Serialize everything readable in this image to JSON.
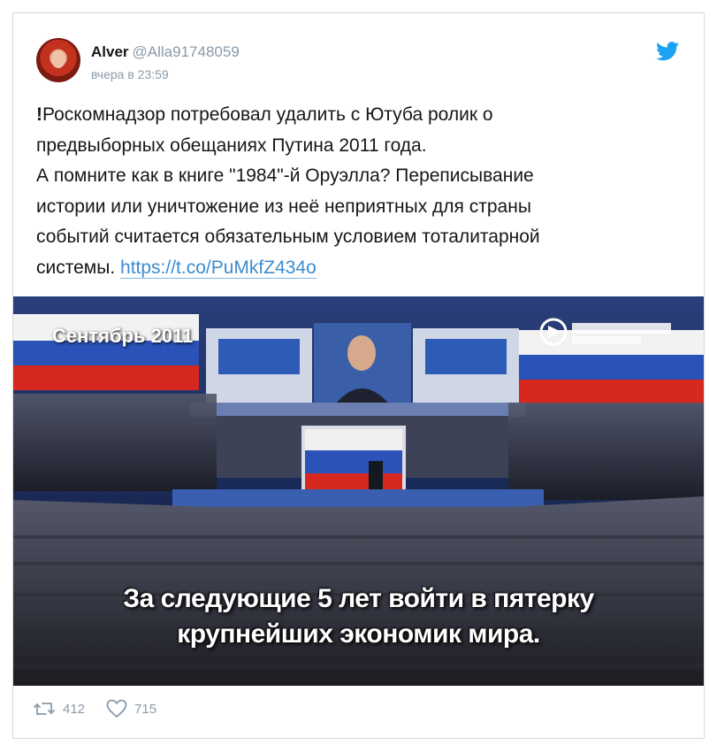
{
  "tweet": {
    "author_name": "Alver",
    "author_handle": "@Alla91748059",
    "timestamp": "вчера в 23:59",
    "text_lines": [
      "Роскомнадзор потребовал удалить с Ютуба ролик о",
      "предвыборных обещаниях Путина 2011 года.",
      "А помните как в книге \"1984\"-й Оруэлла? Переписывание",
      "истории или уничтожение из неё неприятных для страны",
      "событий считается обязательным условием тоталитарной",
      "системы."
    ],
    "exclamation": "!",
    "link": "https://t.co/PuMkfZ434o",
    "retweets": "412",
    "likes": "715"
  },
  "media": {
    "caption_top": "Сентябрь 2011",
    "subtitle_line1": "За следующие 5 лет войти в пятерку",
    "subtitle_line2": "крупнейших экономик мира."
  },
  "icons": {
    "logo": "twitter-bird-icon",
    "retweet": "retweet-icon",
    "like": "heart-icon"
  },
  "colors": {
    "twitter_blue": "#1da1f2",
    "link": "#3b8ccf",
    "muted": "#8a9aa8"
  }
}
